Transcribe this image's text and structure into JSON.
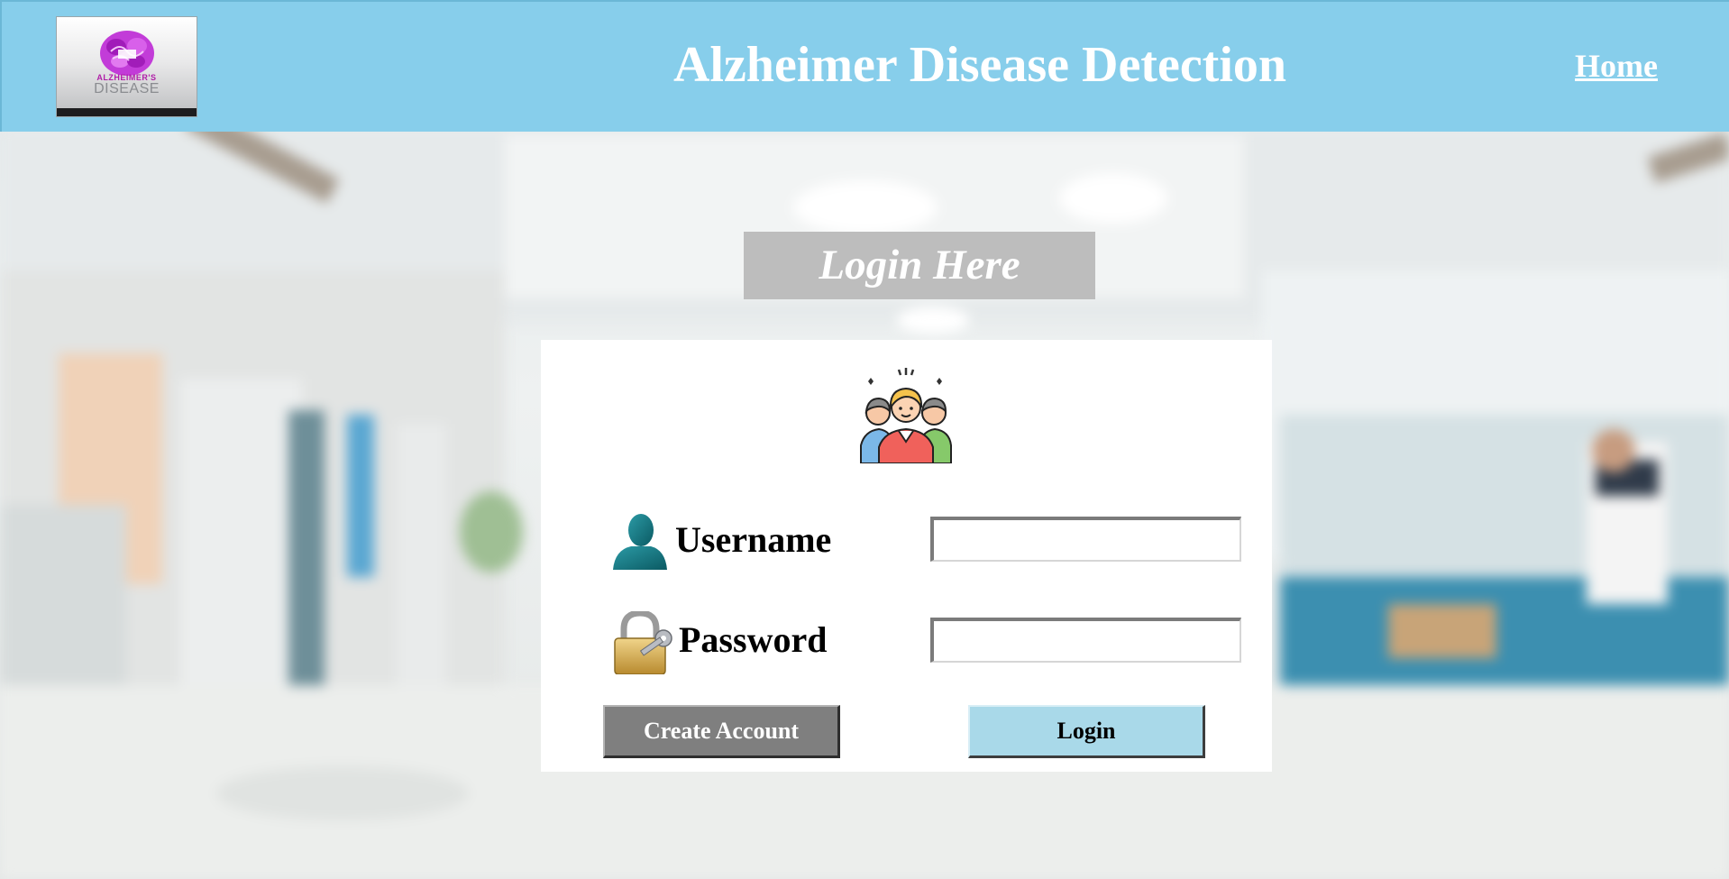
{
  "header": {
    "logo": {
      "name": "alzheimers-disease-logo",
      "word1": "ALZHEIMER'S",
      "word2": "DISEASE",
      "brain_color": "#c23cd8"
    },
    "title": "Alzheimer Disease Detection",
    "nav": {
      "home_label": "Home"
    },
    "background_color": "#87ceeb"
  },
  "login": {
    "heading": "Login Here",
    "icons": {
      "team": "team-people-icon",
      "username": "user-silhouette-icon",
      "password": "padlock-key-icon"
    },
    "fields": {
      "username": {
        "label": "Username",
        "value": "",
        "placeholder": ""
      },
      "password": {
        "label": "Password",
        "value": "",
        "placeholder": ""
      }
    },
    "buttons": {
      "create_account": "Create Account",
      "login": "Login"
    },
    "colors": {
      "heading_bg": "#bdbdbd",
      "create_account_bg": "#7f7f7f",
      "login_bg": "#a9d9e9"
    }
  },
  "background": {
    "description_icon": "hospital-corridor-background"
  }
}
